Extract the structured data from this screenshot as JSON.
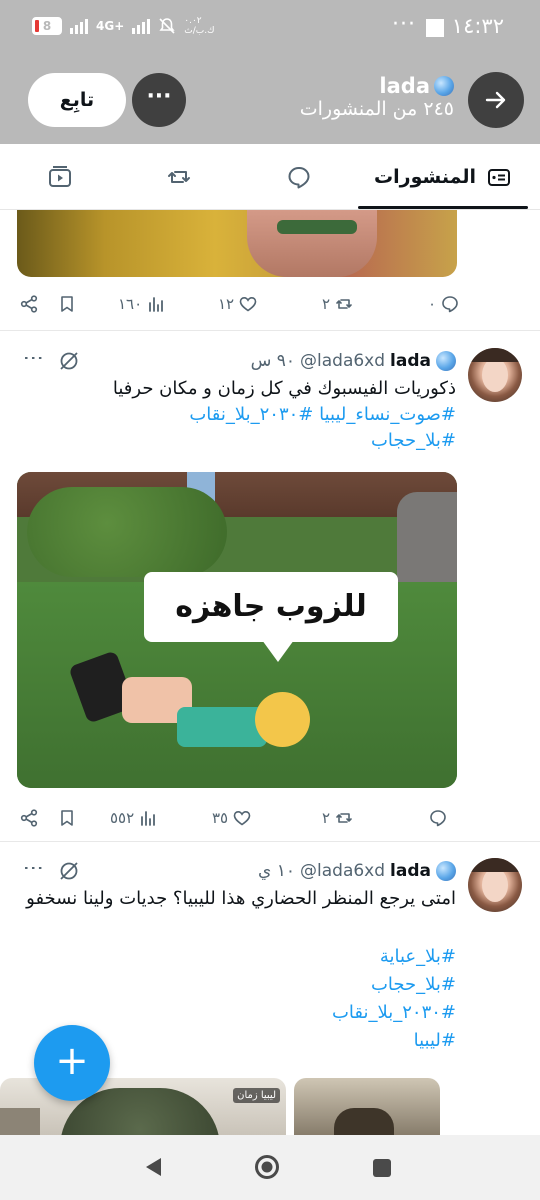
{
  "status_bar": {
    "time": "١٤:٣٢",
    "more": "···",
    "battery": "8",
    "network": "4G+",
    "speed": "٠.٠٢ ك.ب/ث"
  },
  "header": {
    "name": "lada",
    "post_count": "٢٤٥ من المنشورات",
    "follow_label": "تابِع",
    "more_label": "···",
    "back_icon": "arrow-right-icon"
  },
  "tabs": {
    "posts_label": "المنشورات"
  },
  "top_actions": {
    "replies": "٠",
    "reposts": "٢",
    "likes": "١٢",
    "views": "١٦٠"
  },
  "posts": [
    {
      "name": "lada",
      "handle": "@lada6xd",
      "time": "٩٠ س",
      "text": "ذكوريات الفيسبوك في كل زمان و مكان حرفيا",
      "tags": [
        "#صوت_نساء_ليبيا #٢٠٣٠_بلا_نقاب",
        "#بلا_حجاب"
      ],
      "media_caption": "للزوب جاهزه",
      "actions": {
        "replies": "",
        "reposts": "٢",
        "likes": "٣٥",
        "views": "٥٥٢"
      }
    },
    {
      "name": "lada",
      "handle": "@lada6xd",
      "time": "١٠ ي",
      "text": "امتى يرجع المنظر الحضاري هذا لليبيا؟ جديات ولينا نسخفو",
      "tags": [
        "#بلا_عباية",
        "#بلا_حجاب",
        "#٢٠٣٠_بلا_نقاب",
        "#ليبيا"
      ],
      "media_watermark": "ليبيا زمان"
    }
  ],
  "fab_label": "+"
}
